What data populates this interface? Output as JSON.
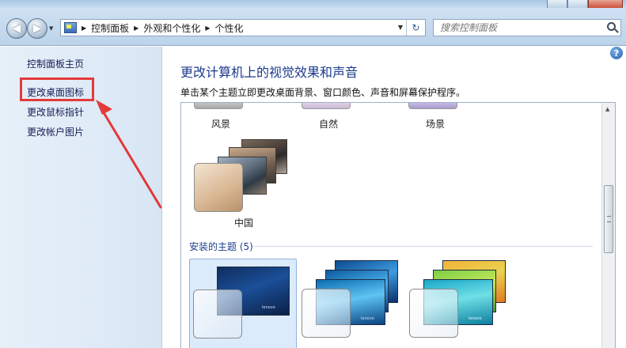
{
  "address_bar": {
    "crumbs": [
      "控制面板",
      "外观和个性化",
      "个性化"
    ]
  },
  "search": {
    "placeholder": "搜索控制面板"
  },
  "sidebar": {
    "items": [
      {
        "label": "控制面板主页"
      },
      {
        "label": "更改桌面图标"
      },
      {
        "label": "更改鼠标指针"
      },
      {
        "label": "更改帐户图片"
      }
    ]
  },
  "main": {
    "title": "更改计算机上的视觉效果和声音",
    "subtitle": "单击某个主题立即更改桌面背景、窗口颜色、声音和屏幕保护程序。",
    "top_themes": [
      "风景",
      "自然",
      "场景"
    ],
    "china_theme": "中国",
    "installed_header": "安装的主题 (5)"
  },
  "colors": {
    "highlight": "#e33a3a",
    "title_blue": "#1b3a8c",
    "selected_tile": "#dcebfc"
  },
  "icons": {
    "back": "back-arrow-icon",
    "forward": "forward-arrow-icon",
    "refresh": "refresh-icon",
    "search": "search-icon",
    "help": "help-icon"
  }
}
